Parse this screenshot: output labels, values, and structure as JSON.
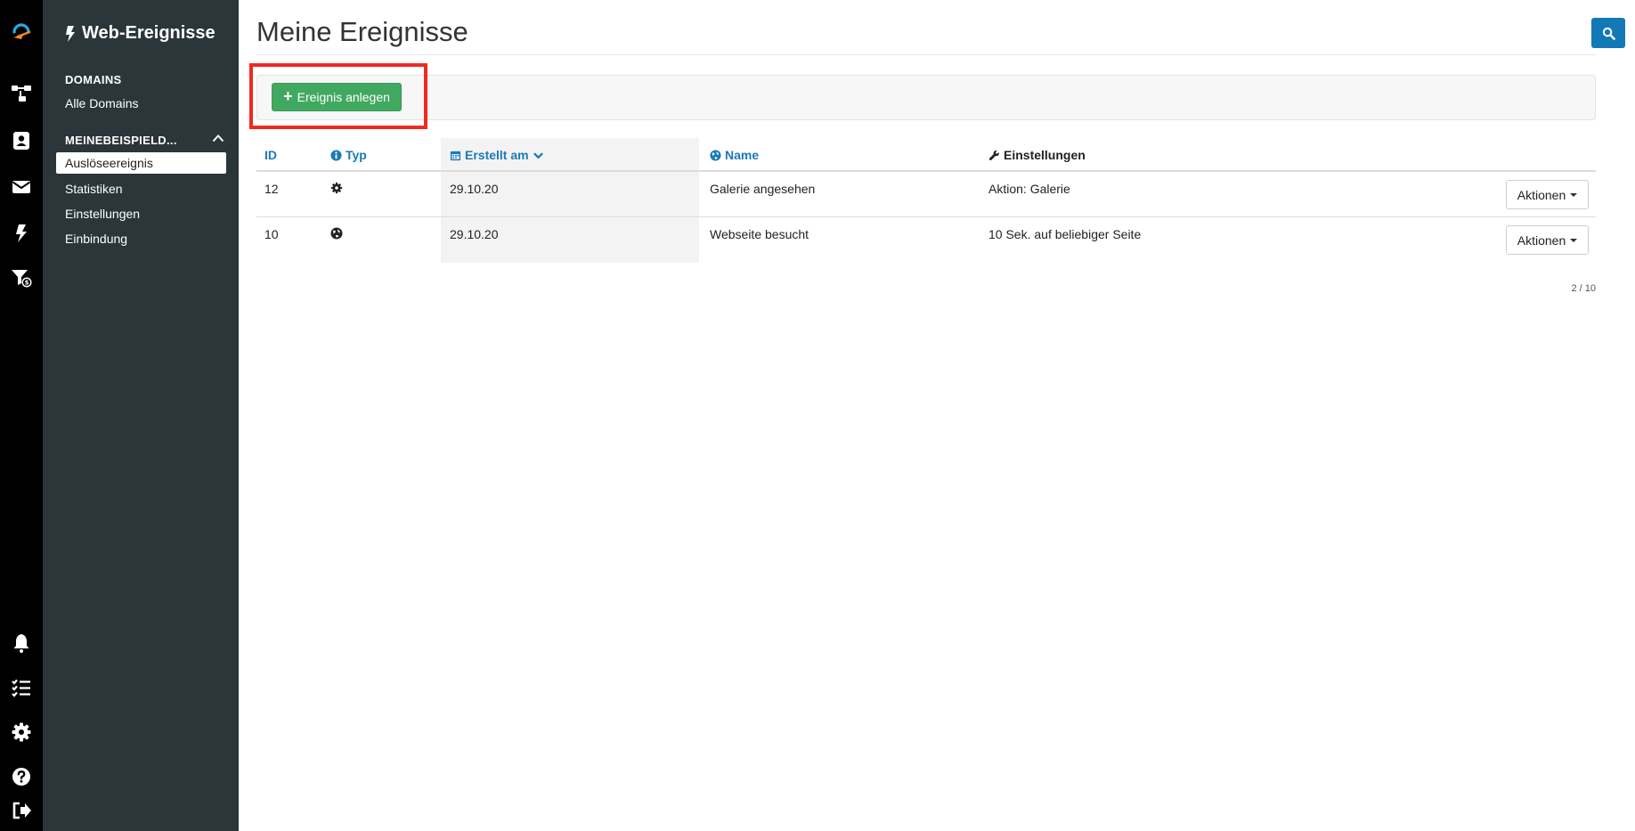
{
  "rail": {
    "icons": [
      "logo-icon",
      "workflow-icon",
      "contacts-icon",
      "mail-icon",
      "bolt-icon",
      "funnel-money-icon",
      "bell-icon",
      "checklist-icon",
      "gear-icon",
      "help-icon",
      "logout-icon"
    ]
  },
  "sidebar": {
    "title": "Web-Ereignisse",
    "section_domains": "DOMAINS",
    "all_domains": "Alle Domains",
    "section_domain": "MEINEBEISPIELD...",
    "items": [
      {
        "label": "Auslöseereignis",
        "active": true
      },
      {
        "label": "Statistiken"
      },
      {
        "label": "Einstellungen"
      },
      {
        "label": "Einbindung"
      }
    ]
  },
  "page": {
    "title": "Meine Ereignisse",
    "add_button": "Ereignis anlegen"
  },
  "table": {
    "columns": {
      "id": "ID",
      "type": "Typ",
      "created": "Erstellt am",
      "name": "Name",
      "settings": "Einstellungen"
    },
    "rows": [
      {
        "id": "12",
        "type_icon": "gear-icon",
        "created": "29.10.20",
        "name": "Galerie angesehen",
        "settings": "Aktion: Galerie",
        "action": "Aktionen"
      },
      {
        "id": "10",
        "type_icon": "globe-icon",
        "created": "29.10.20",
        "name": "Webseite besucht",
        "settings": "10 Sek. auf beliebiger Seite",
        "action": "Aktionen"
      }
    ],
    "pagination": "2 / 10"
  },
  "colors": {
    "rail_bg": "#000000",
    "sidebar_bg": "#2b353a",
    "accent_blue": "#1379b6",
    "add_green": "#41a85f",
    "highlight_red": "#ee2a23"
  }
}
